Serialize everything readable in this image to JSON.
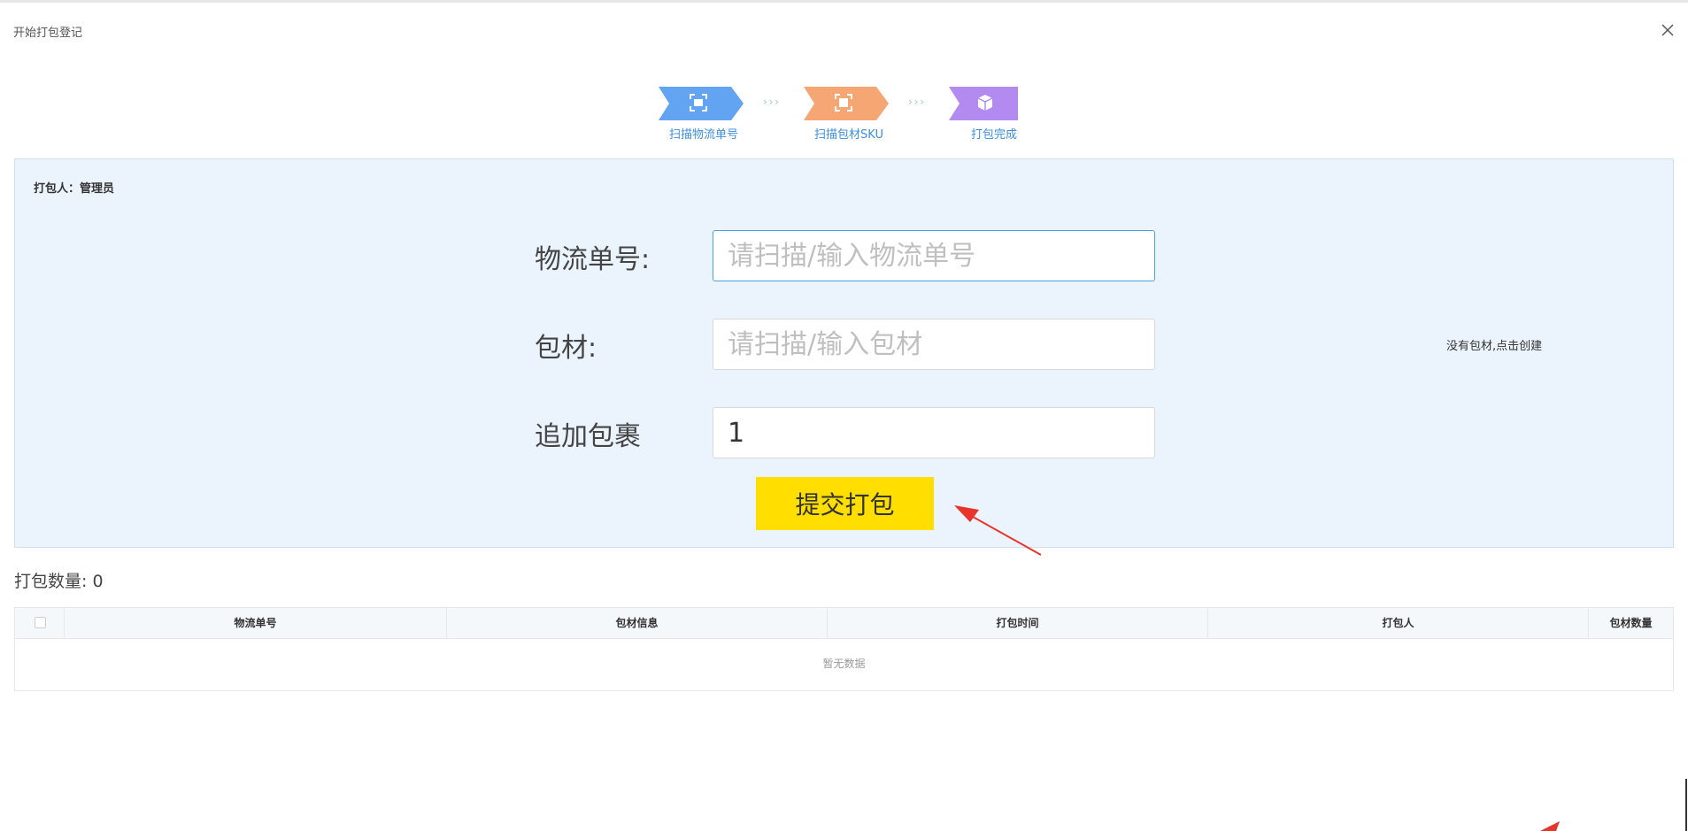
{
  "dialog": {
    "title": "开始打包登记"
  },
  "steps": [
    {
      "label": "扫描物流单号",
      "color": "#62a3f2",
      "icon": "scan-icon"
    },
    {
      "label": "扫描包材SKU",
      "color": "#f5a673",
      "icon": "scan-icon"
    },
    {
      "label": "打包完成",
      "color": "#b28af0",
      "icon": "box-icon"
    }
  ],
  "panel": {
    "packer": "打包人：管理员",
    "fields": [
      {
        "label": "物流单号:",
        "placeholder": "请扫描/输入物流单号",
        "value": ""
      },
      {
        "label": "包材:",
        "placeholder": "请扫描/输入包材",
        "value": ""
      },
      {
        "label": "追加包裹",
        "placeholder": "",
        "value": "1"
      }
    ],
    "create_link": "没有包材,点击创建",
    "submit_label": "提交打包"
  },
  "summary": {
    "count_label": "打包数量:",
    "count_value": "0"
  },
  "table": {
    "columns": [
      "物流单号",
      "包材信息",
      "打包时间",
      "打包人",
      "包材数量"
    ],
    "empty_text": "暂无数据"
  },
  "colors": {
    "panel_bg": "#ebf4fd",
    "submit_bg": "#ffde00",
    "accent": "#3c8dde"
  }
}
